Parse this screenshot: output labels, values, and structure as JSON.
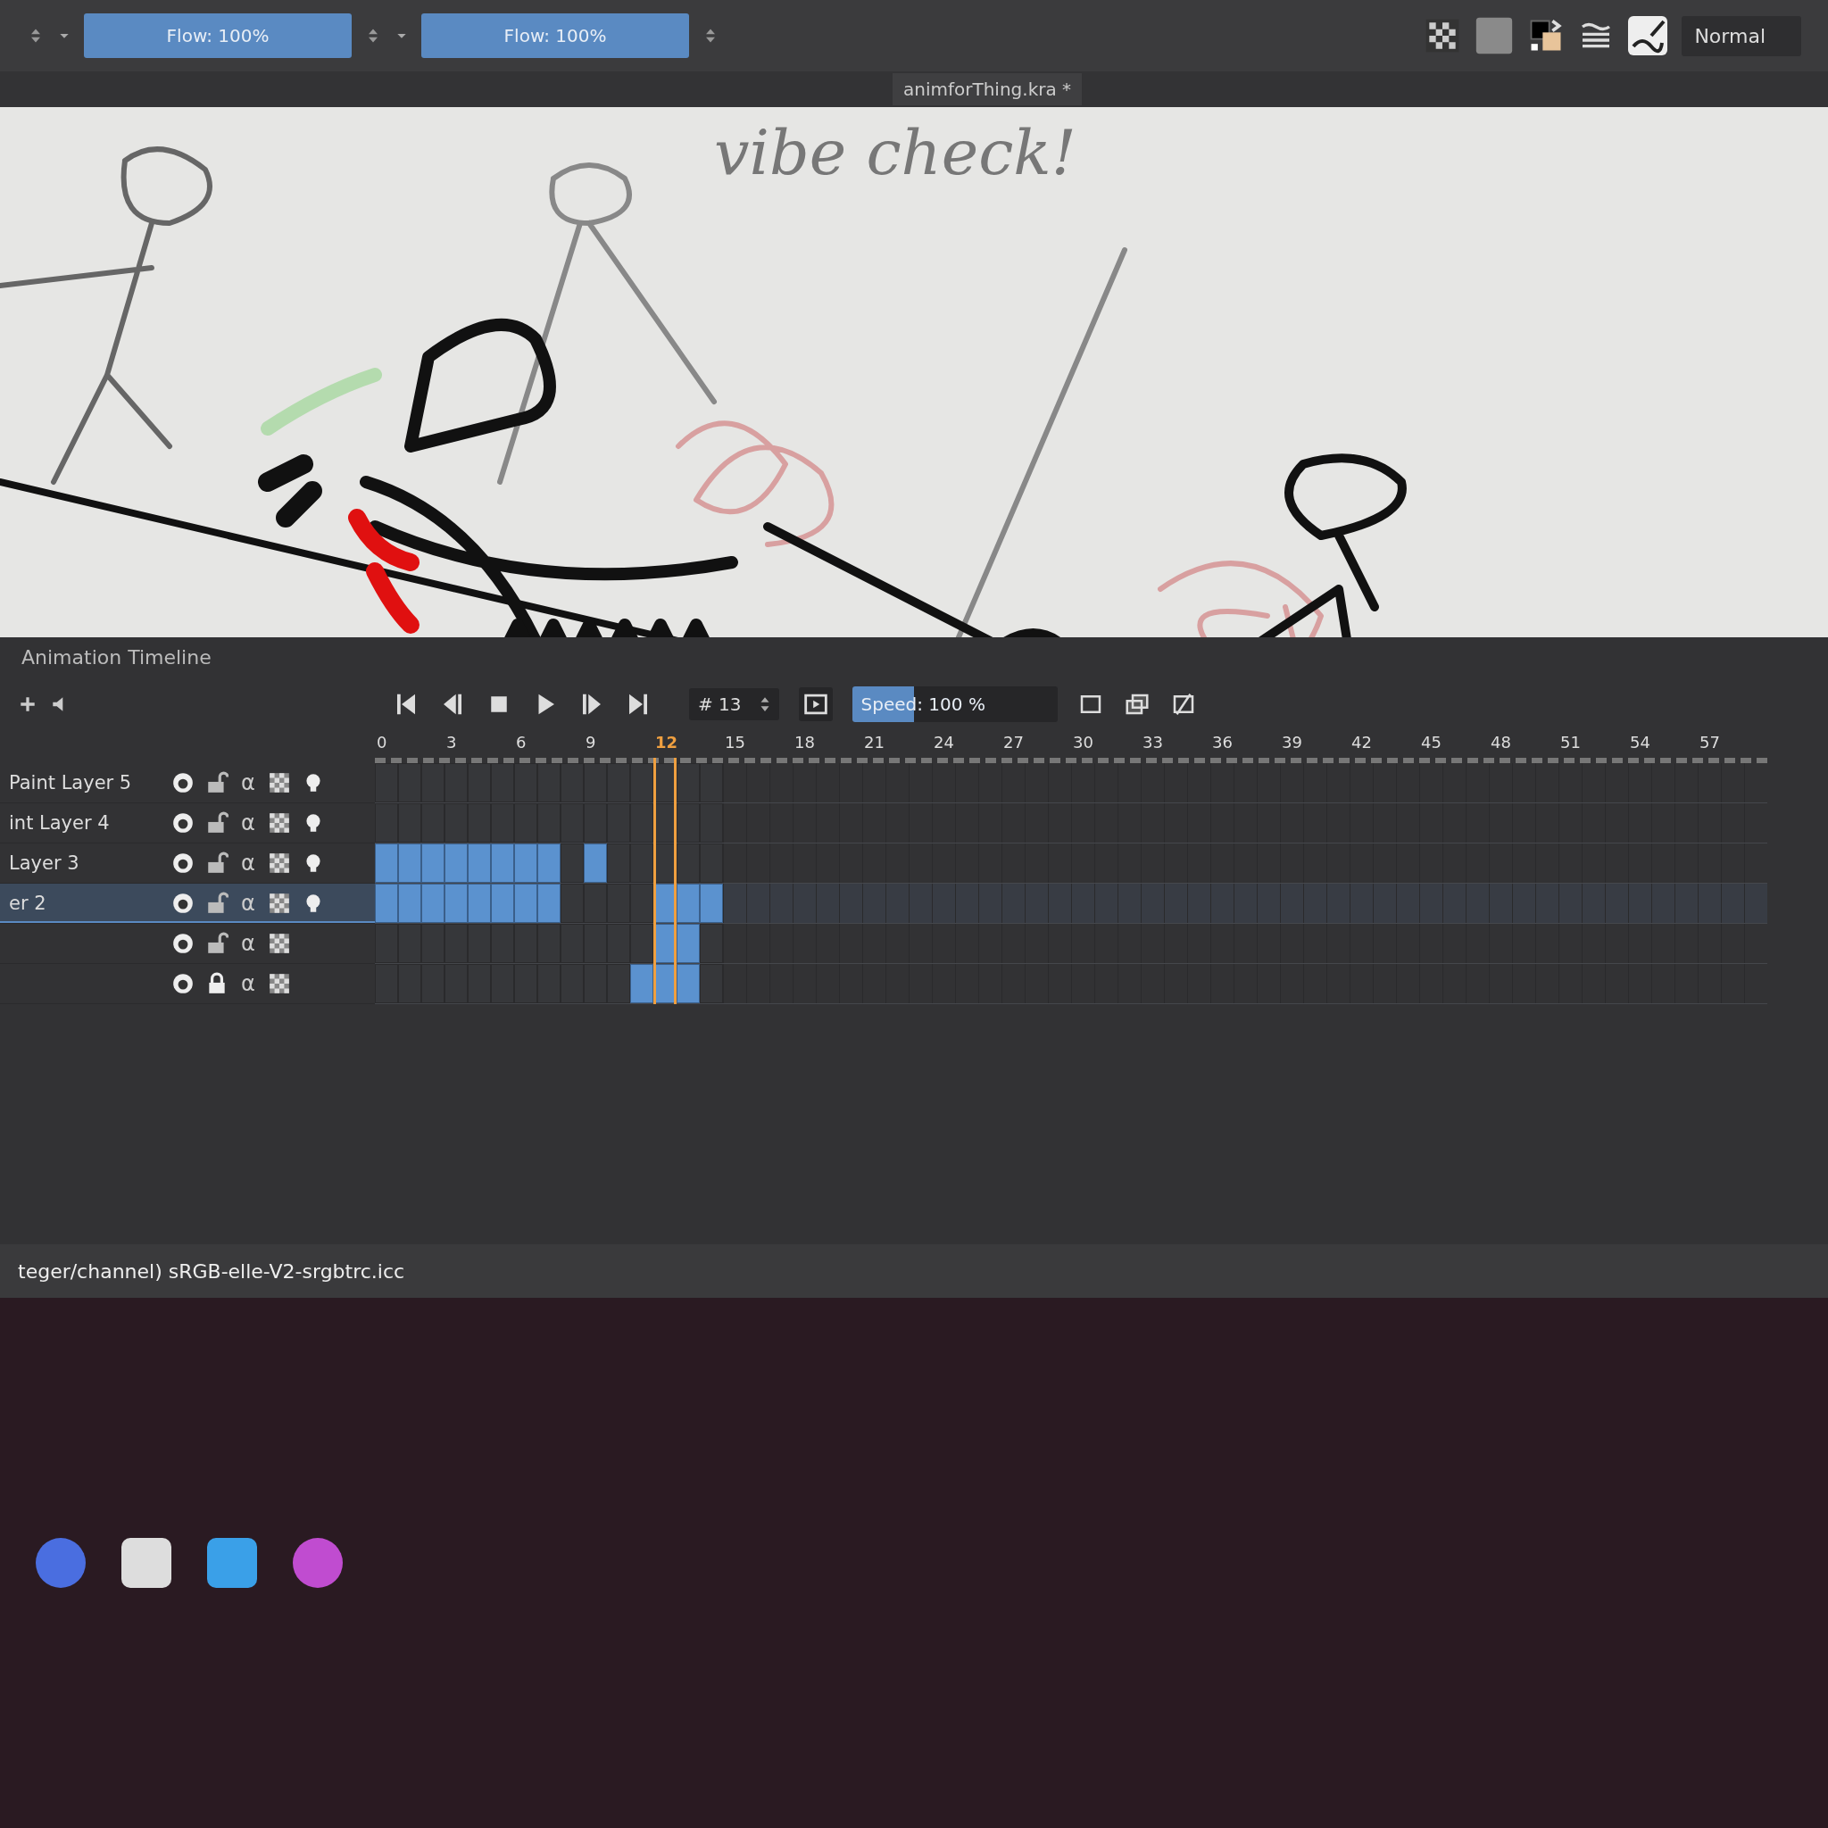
{
  "toolbar": {
    "sliders": [
      {
        "label": "Flow: 100%",
        "level": 1.0
      },
      {
        "label": "Flow: 100%",
        "level": 1.0
      }
    ],
    "blend_mode": "Normal"
  },
  "document_tab": {
    "title": "animforThing.kra *"
  },
  "canvas": {
    "handwritten_text": "vibe check!"
  },
  "timeline": {
    "title": "Animation Timeline",
    "frame_field": "# 13",
    "speed": {
      "label": "Speed: 100 %",
      "level": 0.3
    },
    "ruler": [
      {
        "label": "0",
        "current": false
      },
      {
        "label": "3",
        "current": false
      },
      {
        "label": "6",
        "current": false
      },
      {
        "label": "9",
        "current": false
      },
      {
        "label": "12",
        "current": true
      },
      {
        "label": "15",
        "current": false
      },
      {
        "label": "18",
        "current": false
      },
      {
        "label": "21",
        "current": false
      },
      {
        "label": "24",
        "current": false
      },
      {
        "label": "27",
        "current": false
      },
      {
        "label": "30",
        "current": false
      },
      {
        "label": "33",
        "current": false
      },
      {
        "label": "36",
        "current": false
      },
      {
        "label": "39",
        "current": false
      },
      {
        "label": "42",
        "current": false
      },
      {
        "label": "45",
        "current": false
      },
      {
        "label": "48",
        "current": false
      },
      {
        "label": "51",
        "current": false
      },
      {
        "label": "54",
        "current": false
      },
      {
        "label": "57",
        "current": false
      }
    ],
    "layers": [
      {
        "name": "Paint Layer 5",
        "alpha_icon": "α",
        "locked": false,
        "onion_skin": true,
        "selected": false,
        "keys": [
          false,
          false,
          false,
          false,
          false,
          false,
          false,
          false,
          false,
          false,
          false,
          false,
          false,
          false,
          false
        ]
      },
      {
        "name": "int Layer 4",
        "alpha_icon": "α",
        "locked": false,
        "onion_skin": true,
        "selected": false,
        "keys": [
          false,
          false,
          false,
          false,
          false,
          false,
          false,
          false,
          false,
          false,
          false,
          false,
          false,
          false,
          false
        ]
      },
      {
        "name": "Layer 3",
        "alpha_icon": "α",
        "locked": false,
        "onion_skin": true,
        "selected": false,
        "keys": [
          true,
          true,
          true,
          true,
          true,
          true,
          true,
          true,
          false,
          true,
          false,
          false,
          false,
          false,
          false
        ]
      },
      {
        "name": "er 2",
        "alpha_icon": "α",
        "locked": false,
        "onion_skin": true,
        "selected": true,
        "keys": [
          true,
          true,
          true,
          true,
          true,
          true,
          true,
          true,
          false,
          false,
          false,
          false,
          true,
          true,
          true
        ]
      },
      {
        "alpha_icon": "α",
        "locked": false,
        "onion_skin": false,
        "selected": false,
        "keys": [
          false,
          false,
          false,
          false,
          false,
          false,
          false,
          false,
          false,
          false,
          false,
          false,
          true,
          true,
          false
        ]
      },
      {
        "alpha_icon": "α",
        "locked": true,
        "onion_skin": false,
        "selected": false,
        "keys": [
          false,
          false,
          false,
          false,
          false,
          false,
          false,
          false,
          false,
          false,
          false,
          true,
          true,
          true,
          false
        ]
      }
    ]
  },
  "status_bar": {
    "text": "teger/channel) sRGB-elle-V2-srgbtrc.icc"
  }
}
